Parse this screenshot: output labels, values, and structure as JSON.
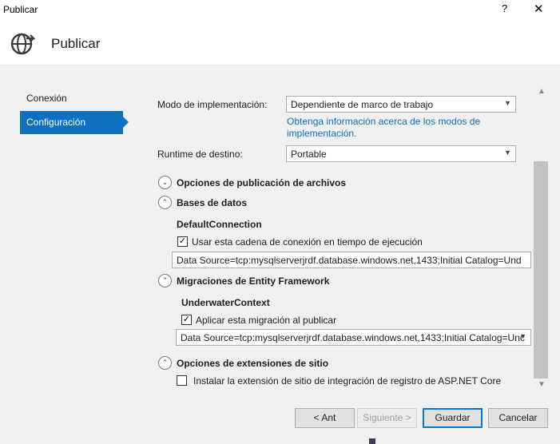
{
  "window": {
    "title": "Publicar",
    "help_glyph": "?",
    "close_glyph": "✕"
  },
  "header": {
    "title": "Publicar",
    "icon": "globe-publish-icon"
  },
  "sidebar": {
    "items": [
      {
        "label": "Conexión"
      },
      {
        "label": "Configuración"
      }
    ]
  },
  "settings": {
    "mode_label": "Modo de implementación:",
    "mode_value": "Dependiente de marco de trabajo",
    "mode_link": "Obtenga información acerca de los modos de implementación.",
    "runtime_label": "Runtime de destino:",
    "runtime_value": "Portable"
  },
  "sections": {
    "file_options": {
      "title": "Opciones de publicación de archivos",
      "toggle": "⌄"
    },
    "databases": {
      "title": "Bases de datos",
      "toggle": "⌃",
      "connection_name": "DefaultConnection",
      "checkbox_label": "Usar esta cadena de conexión en tiempo de ejecución",
      "checked": true,
      "connection_string": "Data Source=tcp:mysqlserverjrdf.database.windows.net,1433;Initial Catalog=Und"
    },
    "ef_migrations": {
      "title": "Migraciones de Entity Framework",
      "toggle": "⌃",
      "context_name": "UnderwaterContext",
      "checkbox_label": "Aplicar esta migración al publicar",
      "checked": true,
      "connection_string": "Data Source=tcp:mysqlserverjrdf.database.windows.net,1433;Initial Catalog=Unc"
    },
    "site_extensions": {
      "title": "Opciones de extensiones de sitio",
      "toggle": "⌃",
      "checkbox_label": "Instalar la extensión de sitio de integración de registro de ASP.NET Core",
      "checked": false
    }
  },
  "buttons": {
    "back": "< Ant",
    "next": "Siguiente >",
    "save": "Guardar",
    "cancel": "Cancelar"
  },
  "glyphs": {
    "check": "✓",
    "dropdown": "▼",
    "scroll_up": "▲",
    "scroll_down": "▼"
  },
  "colors": {
    "accent": "#0e70c0",
    "link": "#0e70c0"
  }
}
